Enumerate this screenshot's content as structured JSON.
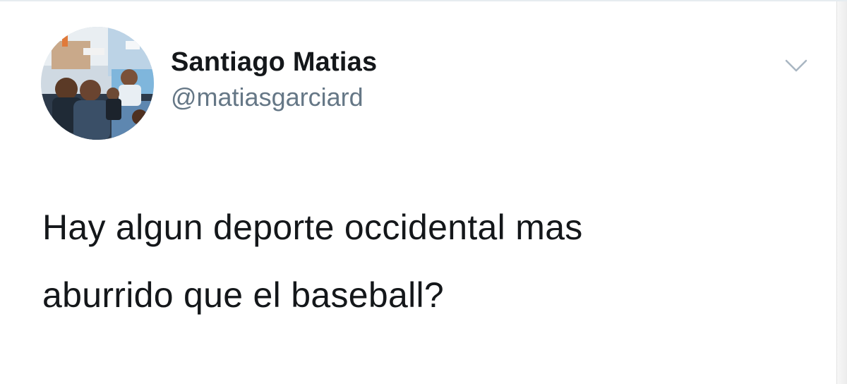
{
  "author": {
    "display_name": "Santiago Matias",
    "handle": "@matiasgarciard",
    "avatar_icon": "profile-photo-collage"
  },
  "menu": {
    "icon": "chevron-down-icon"
  },
  "tweet": {
    "text": "Hay algun deporte occidental mas\naburrido que el baseball?"
  },
  "colors": {
    "name": "#14171a",
    "handle": "#657786",
    "caret": "#a9b6c2",
    "background": "#ffffff"
  }
}
